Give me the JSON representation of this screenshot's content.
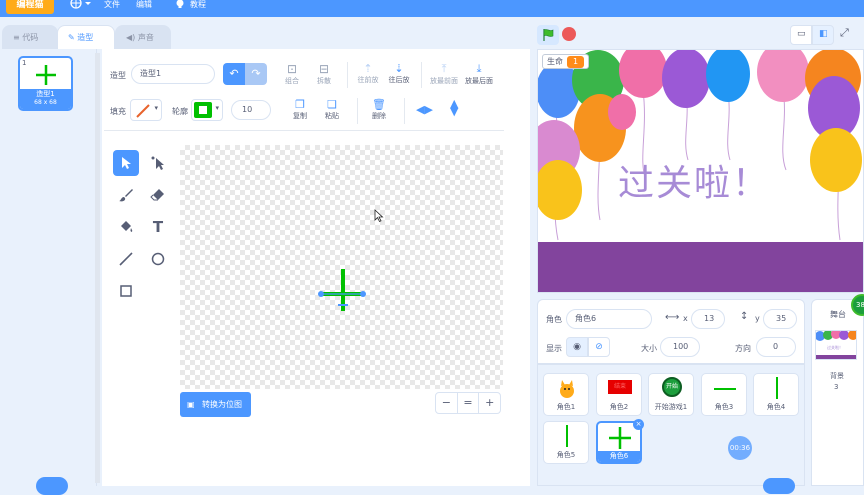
{
  "menubar": {
    "logo": "编程猫",
    "items": [
      "文件",
      "编辑",
      "教程"
    ]
  },
  "tabs": [
    "代码",
    "造型",
    "声音"
  ],
  "costume_list": {
    "items": [
      {
        "index": "1",
        "name": "造型1",
        "size": "68 x 68"
      }
    ]
  },
  "editor": {
    "costume_label": "造型",
    "costume_name": "造型1",
    "toolbar_top": [
      "组合",
      "拆散",
      "往前放",
      "往后放",
      "放最前面",
      "放最后面"
    ],
    "fill_label": "填充",
    "outline_label": "轮廓",
    "outline_size": "10",
    "toolbar_bottom": [
      "复制",
      "粘贴",
      "删除"
    ],
    "convert_label": "转换为位图",
    "zoom": [
      "−",
      "=",
      "+"
    ]
  },
  "stage": {
    "variable_label": "生命",
    "variable_value": "1",
    "heading": "过关啦！"
  },
  "sprite_info": {
    "sprite_label": "角色",
    "sprite_name": "角色6",
    "x_label": "x",
    "x_value": "13",
    "y_label": "y",
    "y_value": "35",
    "show_label": "显示",
    "size_label": "大小",
    "size_value": "100",
    "direction_label": "方向",
    "direction_value": "0"
  },
  "sprites": [
    {
      "name": "角色1",
      "thumb": "cat"
    },
    {
      "name": "角色2",
      "thumb": "red-sign",
      "thumb_text": "结束"
    },
    {
      "name": "开始游戏1",
      "thumb": "green-button",
      "thumb_text": "开始"
    },
    {
      "name": "角色3",
      "thumb": "green-hline"
    },
    {
      "name": "角色4",
      "thumb": "green-vline"
    },
    {
      "name": "角色5",
      "thumb": "green-vline"
    },
    {
      "name": "角色6",
      "thumb": "green-cross",
      "selected": true
    }
  ],
  "timer_badge": "00:36",
  "stage_panel": {
    "title": "舞台",
    "thumb_text": "过关啦！",
    "backdrop_label": "背景",
    "backdrop_count": "3",
    "badge": "38"
  },
  "colors": {
    "accent": "#4c97ff",
    "outline_green": "#00c000",
    "stage_purple": "#82449d",
    "heading_purple": "#a78bd6"
  }
}
